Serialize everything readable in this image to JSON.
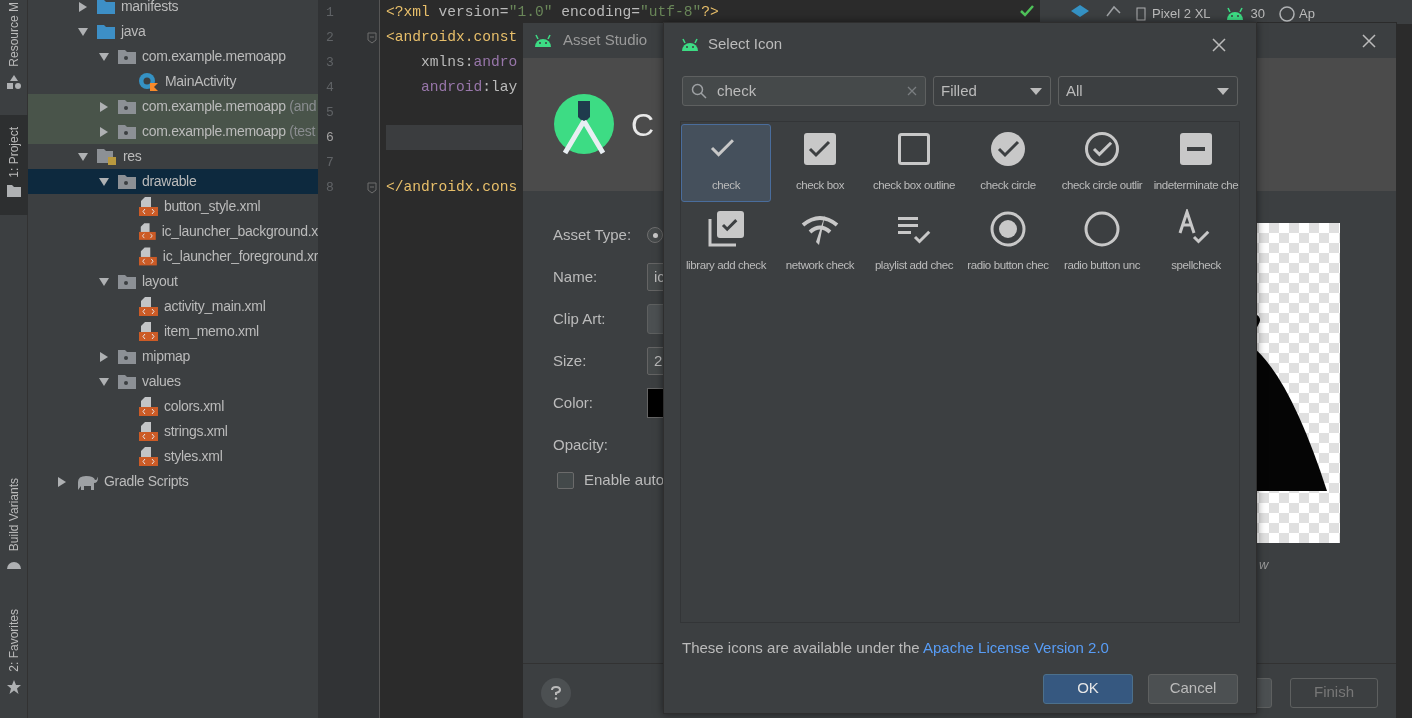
{
  "tool_strip": [
    {
      "label": "Resource M",
      "selected": false
    },
    {
      "label": "1: Project",
      "selected": true
    },
    {
      "label": "Build Variants",
      "selected": false
    },
    {
      "label": "2: Favorites",
      "selected": false
    }
  ],
  "project_tree": {
    "app_children": [
      {
        "name": "manifests",
        "kind": "folder-blue",
        "expanded": false
      },
      {
        "name": "java",
        "kind": "folder-blue",
        "expanded": true,
        "children": [
          {
            "name": "com.example.memoapp",
            "kind": "package",
            "expanded": true,
            "highlighted": false,
            "children": [
              {
                "name": "MainActivity",
                "kind": "kotlin-class"
              }
            ]
          },
          {
            "name": "com.example.memoapp",
            "suffix": "(and",
            "kind": "package",
            "expanded": false,
            "highlighted": true
          },
          {
            "name": "com.example.memoapp",
            "suffix": "(test",
            "kind": "package",
            "expanded": false,
            "highlighted": true
          }
        ]
      },
      {
        "name": "res",
        "kind": "res-folder",
        "expanded": true,
        "children": [
          {
            "name": "drawable",
            "kind": "package",
            "expanded": true,
            "selected": true,
            "children": [
              {
                "name": "button_style.xml",
                "kind": "xml-file"
              },
              {
                "name": "ic_launcher_background.x",
                "kind": "xml-file"
              },
              {
                "name": "ic_launcher_foreground.xr",
                "kind": "xml-file"
              }
            ]
          },
          {
            "name": "layout",
            "kind": "package",
            "expanded": true,
            "selected": false,
            "children": [
              {
                "name": "activity_main.xml",
                "kind": "xml-file"
              },
              {
                "name": "item_memo.xml",
                "kind": "xml-file"
              }
            ]
          },
          {
            "name": "mipmap",
            "kind": "package",
            "expanded": false,
            "selected": false
          },
          {
            "name": "values",
            "kind": "package",
            "expanded": true,
            "selected": false,
            "children": [
              {
                "name": "colors.xml",
                "kind": "xml-file"
              },
              {
                "name": "strings.xml",
                "kind": "xml-file"
              },
              {
                "name": "styles.xml",
                "kind": "xml-file"
              }
            ]
          }
        ]
      }
    ],
    "roots": [
      {
        "name": "Gradle Scripts",
        "kind": "gradle",
        "expanded": false
      }
    ]
  },
  "editor": {
    "lines": [
      {
        "number": "1",
        "fold": false,
        "current": false,
        "tokens": [
          {
            "kind": "tag",
            "text": "<?xml"
          },
          {
            "kind": "attr",
            "text": " version="
          },
          {
            "kind": "string",
            "text": "\"1.0\""
          },
          {
            "kind": "attr",
            "text": " encoding="
          },
          {
            "kind": "string",
            "text": "\"utf-8\""
          },
          {
            "kind": "tag",
            "text": "?>"
          }
        ]
      },
      {
        "number": "2",
        "fold": true,
        "current": false,
        "tokens": [
          {
            "kind": "tag",
            "text": "<androidx.const"
          }
        ]
      },
      {
        "number": "3",
        "fold": false,
        "current": false,
        "tokens": [
          {
            "kind": "attr",
            "text": "    xmlns:"
          },
          {
            "kind": "ns",
            "text": "andro"
          }
        ]
      },
      {
        "number": "4",
        "fold": false,
        "current": false,
        "tokens": [
          {
            "kind": "ns",
            "text": "    android"
          },
          {
            "kind": "attr",
            "text": ":lay"
          }
        ]
      },
      {
        "number": "5",
        "fold": false,
        "current": false
      },
      {
        "number": "6",
        "fold": false,
        "current": true
      },
      {
        "number": "7",
        "fold": false,
        "current": false
      },
      {
        "number": "8",
        "fold": true,
        "current": false,
        "tokens": [
          {
            "kind": "tag",
            "text": "</androidx.cons"
          }
        ]
      }
    ]
  },
  "design_toolbar": {
    "device": "Pixel 2 XL",
    "api": "30",
    "theme": "Ap"
  },
  "asset_studio": {
    "title": "Asset Studio",
    "heading": "C",
    "rows": [
      {
        "label": "Asset Type:",
        "kind": "radio",
        "checked": true
      },
      {
        "label": "Name:",
        "kind": "text",
        "value": "ic"
      },
      {
        "label": "Clip Art:",
        "kind": "button"
      },
      {
        "label": "Size:",
        "kind": "text",
        "value": "2"
      },
      {
        "label": "Color:",
        "kind": "color",
        "color": "#000000"
      },
      {
        "label": "Opacity:",
        "kind": "label"
      }
    ],
    "checkbox": {
      "label": "Enable auto",
      "checked": false
    },
    "preview_label": "w",
    "finish": "Finish"
  },
  "select_icon": {
    "title": "Select Icon",
    "search": {
      "value": "check"
    },
    "style": "Filled",
    "category": "All",
    "icons": [
      {
        "label": "check",
        "kind": "check",
        "selected": true
      },
      {
        "label": "check box",
        "kind": "check-box",
        "selected": false
      },
      {
        "label": "check box outline",
        "kind": "check-box-outline",
        "selected": false
      },
      {
        "label": "check circle",
        "kind": "check-circle",
        "selected": false
      },
      {
        "label": "check circle outlir",
        "kind": "check-circle-outline",
        "selected": false
      },
      {
        "label": "indeterminate che",
        "kind": "indeterminate",
        "selected": false
      },
      {
        "label": "library add check",
        "kind": "library-add-check",
        "selected": false
      },
      {
        "label": "network check",
        "kind": "network-check",
        "selected": false
      },
      {
        "label": "playlist add chec",
        "kind": "playlist-add-check",
        "selected": false
      },
      {
        "label": "radio button chec",
        "kind": "radio-checked",
        "selected": false
      },
      {
        "label": "radio button unc",
        "kind": "radio-unchecked",
        "selected": false
      },
      {
        "label": "spellcheck",
        "kind": "spellcheck",
        "selected": false
      }
    ],
    "license_text": "These icons are available under the ",
    "license_link": "Apache License Version 2.0",
    "ok": "OK",
    "cancel": "Cancel"
  }
}
